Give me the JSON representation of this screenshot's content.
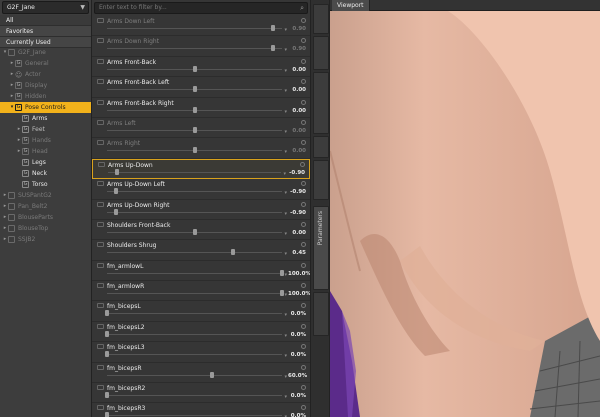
{
  "scene": {
    "selector": "G2F_Jane",
    "categories": [
      "All",
      "Favorites",
      "Currently Used"
    ],
    "tree": [
      {
        "label": "G2F_Jane",
        "indent": 0,
        "state": "dim",
        "tri": "▾",
        "icon": "figure-icon"
      },
      {
        "label": "General",
        "indent": 1,
        "state": "dim",
        "tri": "▸",
        "icon": "group-icon"
      },
      {
        "label": "Actor",
        "indent": 1,
        "state": "dim",
        "tri": "▸",
        "icon": "person-icon"
      },
      {
        "label": "Display",
        "indent": 1,
        "state": "dim",
        "tri": "▸",
        "icon": "group-icon"
      },
      {
        "label": "Hidden",
        "indent": 1,
        "state": "dim",
        "tri": "▸",
        "icon": "group-icon"
      },
      {
        "label": "Pose Controls",
        "indent": 1,
        "state": "sel",
        "tri": "▾",
        "icon": "group-icon"
      },
      {
        "label": "Arms",
        "indent": 2,
        "state": "bold",
        "tri": "",
        "icon": "group-icon"
      },
      {
        "label": "Feet",
        "indent": 2,
        "state": "normal",
        "tri": "▸",
        "icon": "group-icon"
      },
      {
        "label": "Hands",
        "indent": 2,
        "state": "dim",
        "tri": "▸",
        "icon": "group-icon"
      },
      {
        "label": "Head",
        "indent": 2,
        "state": "dim",
        "tri": "▸",
        "icon": "group-icon"
      },
      {
        "label": "Legs",
        "indent": 2,
        "state": "bold",
        "tri": "",
        "icon": "group-icon"
      },
      {
        "label": "Neck",
        "indent": 2,
        "state": "bold",
        "tri": "",
        "icon": "group-icon"
      },
      {
        "label": "Torso",
        "indent": 2,
        "state": "bold",
        "tri": "",
        "icon": "group-icon"
      },
      {
        "label": "SUSPantG2",
        "indent": 0,
        "state": "dim",
        "tri": "▸",
        "icon": "figure-icon"
      },
      {
        "label": "Pan_Belt2",
        "indent": 0,
        "state": "dim",
        "tri": "▸",
        "icon": "figure-icon"
      },
      {
        "label": "BlouseParts",
        "indent": 0,
        "state": "dim",
        "tri": "▸",
        "icon": "figure-icon"
      },
      {
        "label": "BlouseTop",
        "indent": 0,
        "state": "dim",
        "tri": "▸",
        "icon": "figure-icon"
      },
      {
        "label": "SSJB2",
        "indent": 0,
        "state": "dim",
        "tri": "▸",
        "icon": "figure-icon"
      }
    ]
  },
  "search": {
    "placeholder": "Enter text to filter by..."
  },
  "parameters": [
    {
      "label": "Arms Down Left",
      "value": "0.90",
      "level": 0.95,
      "faded": true
    },
    {
      "label": "Arms Down Right",
      "value": "0.90",
      "level": 0.95,
      "faded": true
    },
    {
      "label": "Arms Front-Back",
      "value": "0.00",
      "level": 0.5,
      "faded": false
    },
    {
      "label": "Arms Front-Back Left",
      "value": "0.00",
      "level": 0.5,
      "faded": false
    },
    {
      "label": "Arms Front-Back Right",
      "value": "0.00",
      "level": 0.5,
      "faded": false
    },
    {
      "label": "Arms Left",
      "value": "0.00",
      "level": 0.5,
      "faded": true
    },
    {
      "label": "Arms Right",
      "value": "0.00",
      "level": 0.5,
      "faded": true
    },
    {
      "label": "Arms Up-Down",
      "value": "-0.90",
      "level": 0.05,
      "faded": false,
      "active": true
    },
    {
      "label": "Arms Up-Down Left",
      "value": "-0.90",
      "level": 0.05,
      "faded": false
    },
    {
      "label": "Arms Up-Down Right",
      "value": "-0.90",
      "level": 0.05,
      "faded": false
    },
    {
      "label": "Shoulders Front-Back",
      "value": "0.00",
      "level": 0.5,
      "faded": false
    },
    {
      "label": "Shoulders Shrug",
      "value": "0.45",
      "level": 0.72,
      "faded": false
    },
    {
      "label": "fm_armlowL",
      "value": "100.0%",
      "level": 1.0,
      "faded": false
    },
    {
      "label": "fm_armlowR",
      "value": "100.0%",
      "level": 1.0,
      "faded": false
    },
    {
      "label": "fm_bicepsL",
      "value": "0.0%",
      "level": 0.0,
      "faded": false
    },
    {
      "label": "fm_bicepsL2",
      "value": "0.0%",
      "level": 0.0,
      "faded": false
    },
    {
      "label": "fm_bicepsL3",
      "value": "0.0%",
      "level": 0.0,
      "faded": false
    },
    {
      "label": "fm_bicepsR",
      "value": "60.0%",
      "level": 0.6,
      "faded": false
    },
    {
      "label": "fm_bicepsR2",
      "value": "0.0%",
      "level": 0.0,
      "faded": false
    },
    {
      "label": "fm_bicepsR3",
      "value": "0.0%",
      "level": 0.0,
      "faded": false
    }
  ],
  "tabs": [
    "Parameters"
  ],
  "viewport": {
    "title": "Viewport",
    "colors": {
      "skin": "#e3b19a",
      "shadow": "#b98570",
      "purple": "#5b2b8a",
      "floor": "#6b6b6b"
    }
  }
}
